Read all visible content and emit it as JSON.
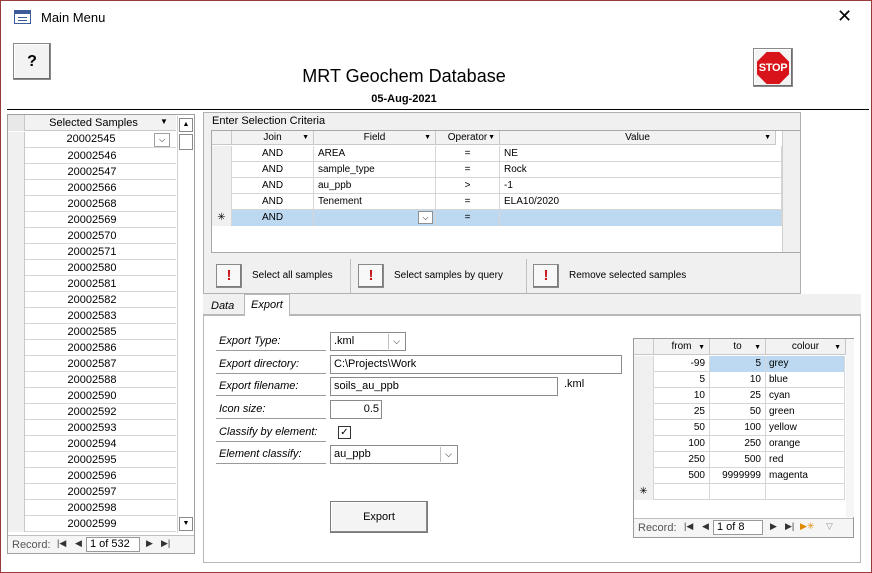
{
  "window": {
    "title": "Main Menu",
    "close_glyph": "✕"
  },
  "header": {
    "help_glyph": "?",
    "title": "MRT Geochem Database",
    "date": "05-Aug-2021",
    "stop_label": "STOP"
  },
  "samples": {
    "header": "Selected Samples",
    "items": [
      "20002545",
      "20002546",
      "20002547",
      "20002566",
      "20002568",
      "20002569",
      "20002570",
      "20002571",
      "20002580",
      "20002581",
      "20002582",
      "20002583",
      "20002585",
      "20002586",
      "20002587",
      "20002588",
      "20002590",
      "20002592",
      "20002593",
      "20002594",
      "20002595",
      "20002596",
      "20002597",
      "20002598",
      "20002599"
    ],
    "record_label": "Record:",
    "record_pos": "1 of 532"
  },
  "criteria": {
    "caption": "Enter Selection Criteria",
    "columns": {
      "join": "Join",
      "field": "Field",
      "operator": "Operator",
      "value": "Value"
    },
    "rows": [
      {
        "join": "AND",
        "field": "AREA",
        "operator": "=",
        "value": "NE"
      },
      {
        "join": "AND",
        "field": "sample_type",
        "operator": "=",
        "value": "Rock"
      },
      {
        "join": "AND",
        "field": "au_ppb",
        "operator": ">",
        "value": "-1"
      },
      {
        "join": "AND",
        "field": "Tenement",
        "operator": "=",
        "value": "ELA10/2020"
      }
    ],
    "new_row": {
      "marker": "✳",
      "join": "AND",
      "operator": "="
    },
    "actions": {
      "select_all": "Select all samples",
      "select_query": "Select samples by query",
      "remove_selected": "Remove selected samples"
    },
    "action_icon": "!"
  },
  "tabs": {
    "data": "Data",
    "export": "Export"
  },
  "export": {
    "type_label": "Export Type:",
    "type_value": ".kml",
    "dir_label": "Export directory:",
    "dir_value": "C:\\Projects\\Work",
    "file_label": "Export filename:",
    "file_value": "soils_au_ppb",
    "file_suffix": ".kml",
    "icon_label": "Icon size:",
    "icon_value": "0.5",
    "classify_label": "Classify by element:",
    "classify_checked": "✓",
    "element_label": "Element classify:",
    "element_value": "au_ppb",
    "button": "Export"
  },
  "colour_table": {
    "columns": {
      "from": "from",
      "to": "to",
      "colour": "colour"
    },
    "rows": [
      {
        "from": "-99",
        "to": "5",
        "colour": "grey"
      },
      {
        "from": "5",
        "to": "10",
        "colour": "blue"
      },
      {
        "from": "10",
        "to": "25",
        "colour": "cyan"
      },
      {
        "from": "25",
        "to": "50",
        "colour": "green"
      },
      {
        "from": "50",
        "to": "100",
        "colour": "yellow"
      },
      {
        "from": "100",
        "to": "250",
        "colour": "orange"
      },
      {
        "from": "250",
        "to": "500",
        "colour": "red"
      },
      {
        "from": "500",
        "to": "9999999",
        "colour": "magenta"
      }
    ],
    "new_marker": "✳",
    "record_label": "Record:",
    "record_pos": "1 of 8"
  }
}
